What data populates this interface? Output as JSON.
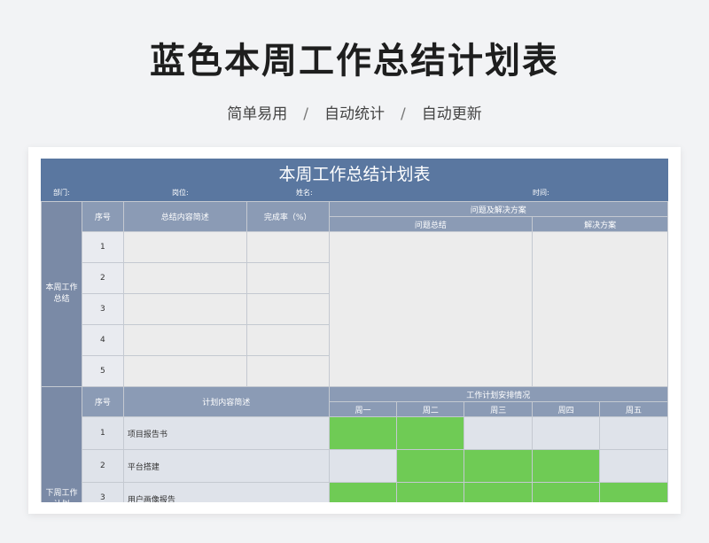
{
  "hero": {
    "title": "蓝色本周工作总结计划表",
    "features": [
      "简单易用",
      "自动统计",
      "自动更新"
    ],
    "separator": "/"
  },
  "sheet": {
    "title": "本周工作总结计划表",
    "meta": {
      "dept": "部门:",
      "position": "岗位:",
      "name": "姓名:",
      "time": "时间:"
    },
    "summary": {
      "side_label": "本周工作总结",
      "col_index": "序号",
      "col_content": "总结内容简述",
      "col_rate": "完成率（%）",
      "col_issues": "问题及解决方案",
      "col_issue_summary": "问题总结",
      "col_solution": "解决方案",
      "rows": [
        "1",
        "2",
        "3",
        "4",
        "5"
      ]
    },
    "plan": {
      "side_label": "下周工作计划",
      "col_index": "序号",
      "col_content": "计划内容简述",
      "col_schedule": "工作计划安排情况",
      "days": [
        "周一",
        "周二",
        "周三",
        "周四",
        "周五"
      ],
      "rows": [
        {
          "index": "1",
          "content": "项目报告书",
          "active": [
            true,
            true,
            false,
            false,
            false
          ]
        },
        {
          "index": "2",
          "content": "平台搭建",
          "active": [
            false,
            true,
            true,
            true,
            false
          ]
        },
        {
          "index": "3",
          "content": "用户画像报告",
          "active": [
            true,
            true,
            true,
            true,
            true
          ]
        }
      ]
    },
    "colors": {
      "header": "#5a77a0",
      "subheader": "#8b9bb5",
      "active": "#6fcb55"
    }
  }
}
